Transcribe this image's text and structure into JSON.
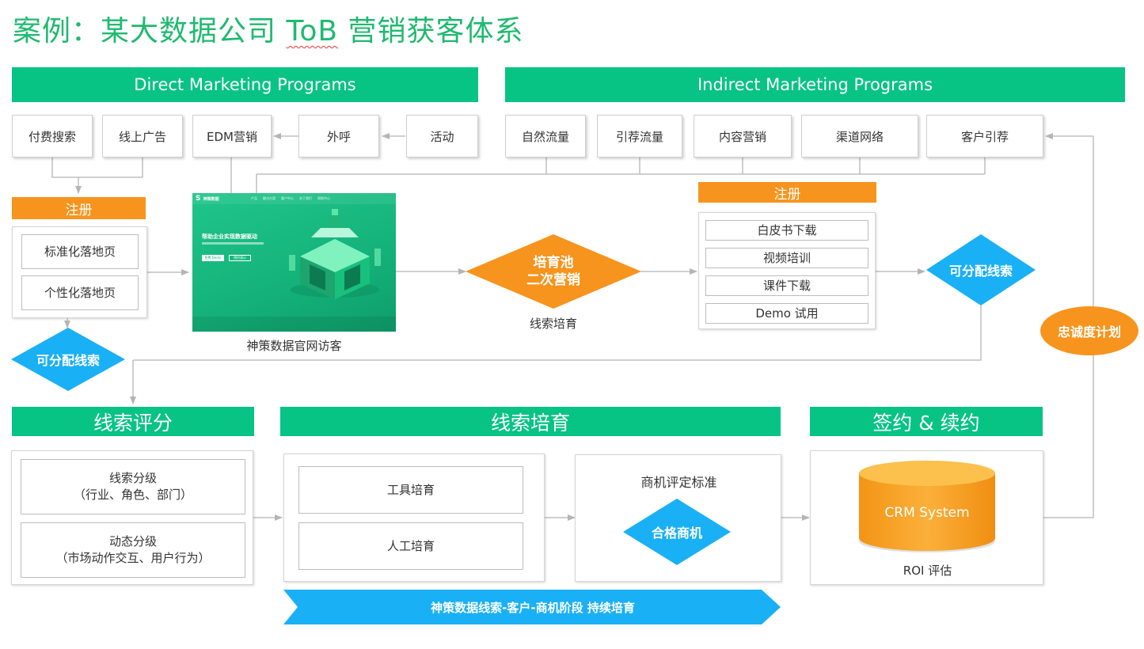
{
  "title": {
    "main": "案例：某大数据公司",
    "tob": "ToB",
    "rest": "营销获客体系"
  },
  "direct_header": "Direct Marketing Programs",
  "indirect_header": "Indirect Marketing Programs",
  "direct_channels": {
    "paid_search": "付费搜索",
    "online_ads": "线上广告",
    "edm": "EDM营销",
    "outbound_call": "外呼",
    "events": "活动"
  },
  "indirect_channels": {
    "organic": "自然流量",
    "referral_traffic": "引荐流量",
    "content": "内容营销",
    "channel_network": "渠道网络",
    "customer_referral": "客户引荐"
  },
  "register_label": "注册",
  "landing_pages": [
    "标准化落地页",
    "个性化落地页"
  ],
  "website": {
    "caption": "神策数据官网访客",
    "logo": "神策数据",
    "headline": "帮助企业实现数据驱动",
    "nav": [
      "产品",
      "解决方案",
      "客户中心",
      "关于我们",
      "帮助中心"
    ],
    "btn_primary": "免费 Demo",
    "btn_secondary": "预约演示"
  },
  "nurture_pool": {
    "label": "培育池\n二次营销",
    "caption": "线索培育"
  },
  "register_right_label": "注册",
  "content_items": [
    "白皮书下载",
    "视频培训",
    "课件下载",
    "Demo 试用"
  ],
  "assignable_leads": "可分配线索",
  "loyalty_program": "忠诚度计划",
  "section_headers": {
    "lead_scoring": "线索评分",
    "lead_nurturing": "线索培育",
    "signing": "签约 & 续约"
  },
  "scoring_items": [
    "线索分级\n（行业、角色、部门）",
    "动态分级\n（市场动作交互、用户行为）"
  ],
  "nurturing_items": [
    "工具培育",
    "人工培育"
  ],
  "opportunity": {
    "title": "商机评定标准",
    "badge": "合格商机"
  },
  "crm": {
    "label": "CRM System",
    "caption": "ROI 评估"
  },
  "bottom_banner": "神策数据线索-客户-商机阶段  持续培育",
  "colors": {
    "green": "#07c384",
    "orange": "#f7941d",
    "blue": "#1ab0f5",
    "title_green": "#1fba6f"
  }
}
